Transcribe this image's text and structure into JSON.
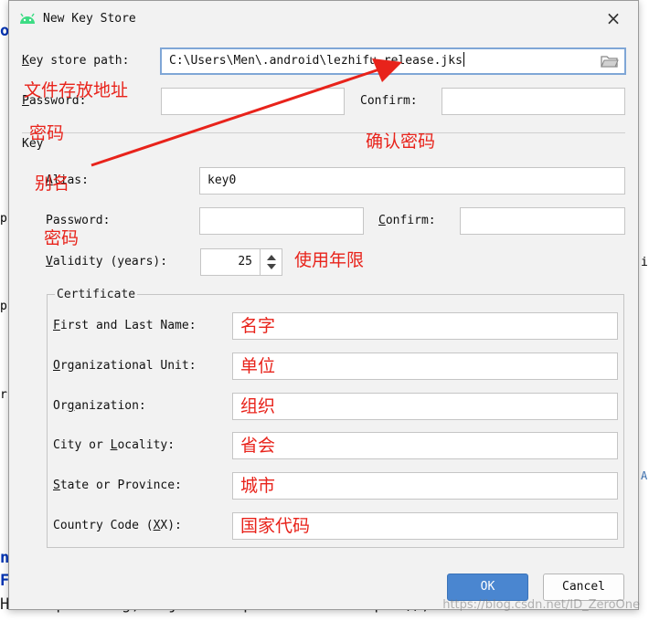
{
  "dialog": {
    "title": "New Key Store",
    "close_glyph": "×"
  },
  "keystore": {
    "path_label_u": "K",
    "path_label_rest": "ey store path:",
    "path_value": "C:\\Users\\Men\\.android\\lezhifu_release.jks",
    "password_label_u": "P",
    "password_label_rest": "assword:",
    "confirm_label": "Confirm:"
  },
  "key": {
    "section_label": "Key",
    "alias_label_u": "A",
    "alias_label_rest": "lias:",
    "alias_value": "key0",
    "password_label": "Password:",
    "confirm_label_u": "C",
    "confirm_label_rest": "onfirm:",
    "validity_label_u": "V",
    "validity_label_rest": "alidity (years):",
    "validity_value": "25"
  },
  "certificate": {
    "legend": "Certificate",
    "fields": [
      {
        "label_u": "F",
        "label_rest": "irst and Last Name:",
        "value": "名字"
      },
      {
        "label_u": "O",
        "label_rest": "rganizational Unit:",
        "value": "单位"
      },
      {
        "label_pre": "Or",
        "label_u": "g",
        "label_rest": "anization:",
        "value": "组织"
      },
      {
        "label_pre": "City or ",
        "label_u": "L",
        "label_rest": "ocality:",
        "value": "省会"
      },
      {
        "label_u": "S",
        "label_rest": "tate or Province:",
        "value": "城市"
      },
      {
        "label_pre": "Country Code (",
        "label_u": "X",
        "label_rest": "X):",
        "value": "国家代码"
      }
    ]
  },
  "buttons": {
    "ok": "OK",
    "cancel": "Cancel"
  },
  "annotations": {
    "path": "文件存放地址",
    "password": "密码",
    "confirm": "确认密码",
    "alias": "别名",
    "key_password": "密码",
    "validity": "使用年限"
  },
  "background": {
    "frag_ox": "ox",
    "frag_p1": "p",
    "frag_p2": "p",
    "frag_r": "r",
    "frag_i": "i",
    "frag_a": "A",
    "frag_nt": "nt",
    "frag_f": "F",
    "code_line": "HashMap<String, Object> map = new HashMap<>();",
    "watermark": "https://blog.csdn.net/ID_ZeroOne"
  },
  "colors": {
    "accent": "#4a86d0",
    "annotation": "#e8231b"
  }
}
